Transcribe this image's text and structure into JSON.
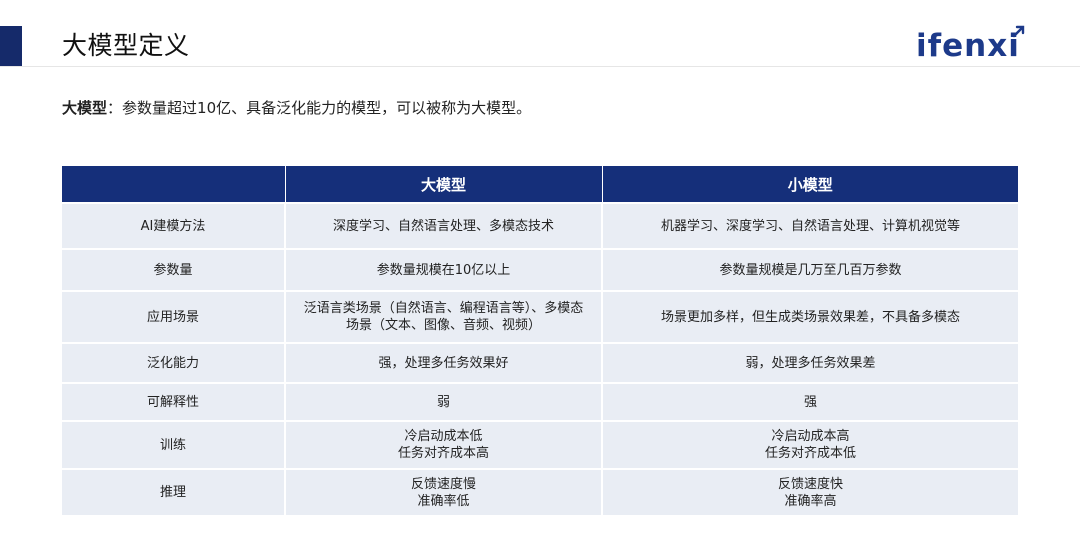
{
  "header": {
    "title": "大模型定义",
    "logo_text": "ifenxi"
  },
  "definition": {
    "term": "大模型",
    "separator": "：",
    "text": "参数量超过10亿、具备泛化能力的模型，可以被称为大模型。"
  },
  "table": {
    "columns": [
      "",
      "大模型",
      "小模型"
    ],
    "rows": [
      {
        "label": "AI建模方法",
        "large": "深度学习、自然语言处理、多模态技术",
        "small": "机器学习、深度学习、自然语言处理、计算机视觉等"
      },
      {
        "label": "参数量",
        "large": "参数量规模在10亿以上",
        "small": "参数量规模是几万至几百万参数"
      },
      {
        "label": "应用场景",
        "large": "泛语言类场景（自然语言、编程语言等）、多模态\n场景（文本、图像、音频、视频）",
        "small": "场景更加多样，但生成类场景效果差，不具备多模态"
      },
      {
        "label": "泛化能力",
        "large": "强，处理多任务效果好",
        "small": "弱，处理多任务效果差"
      },
      {
        "label": "可解释性",
        "large": "弱",
        "small": "强"
      },
      {
        "label": "训练",
        "large": "冷启动成本低\n任务对齐成本高",
        "small": "冷启动成本高\n任务对齐成本低"
      },
      {
        "label": "推理",
        "large": "反馈速度慢\n准确率低",
        "small": "反馈速度快\n准确率高"
      }
    ]
  },
  "colors": {
    "accent": "#152a6a",
    "table_header": "#152f7a",
    "table_cell": "#e9edf4",
    "logo": "#1d3a8a"
  }
}
